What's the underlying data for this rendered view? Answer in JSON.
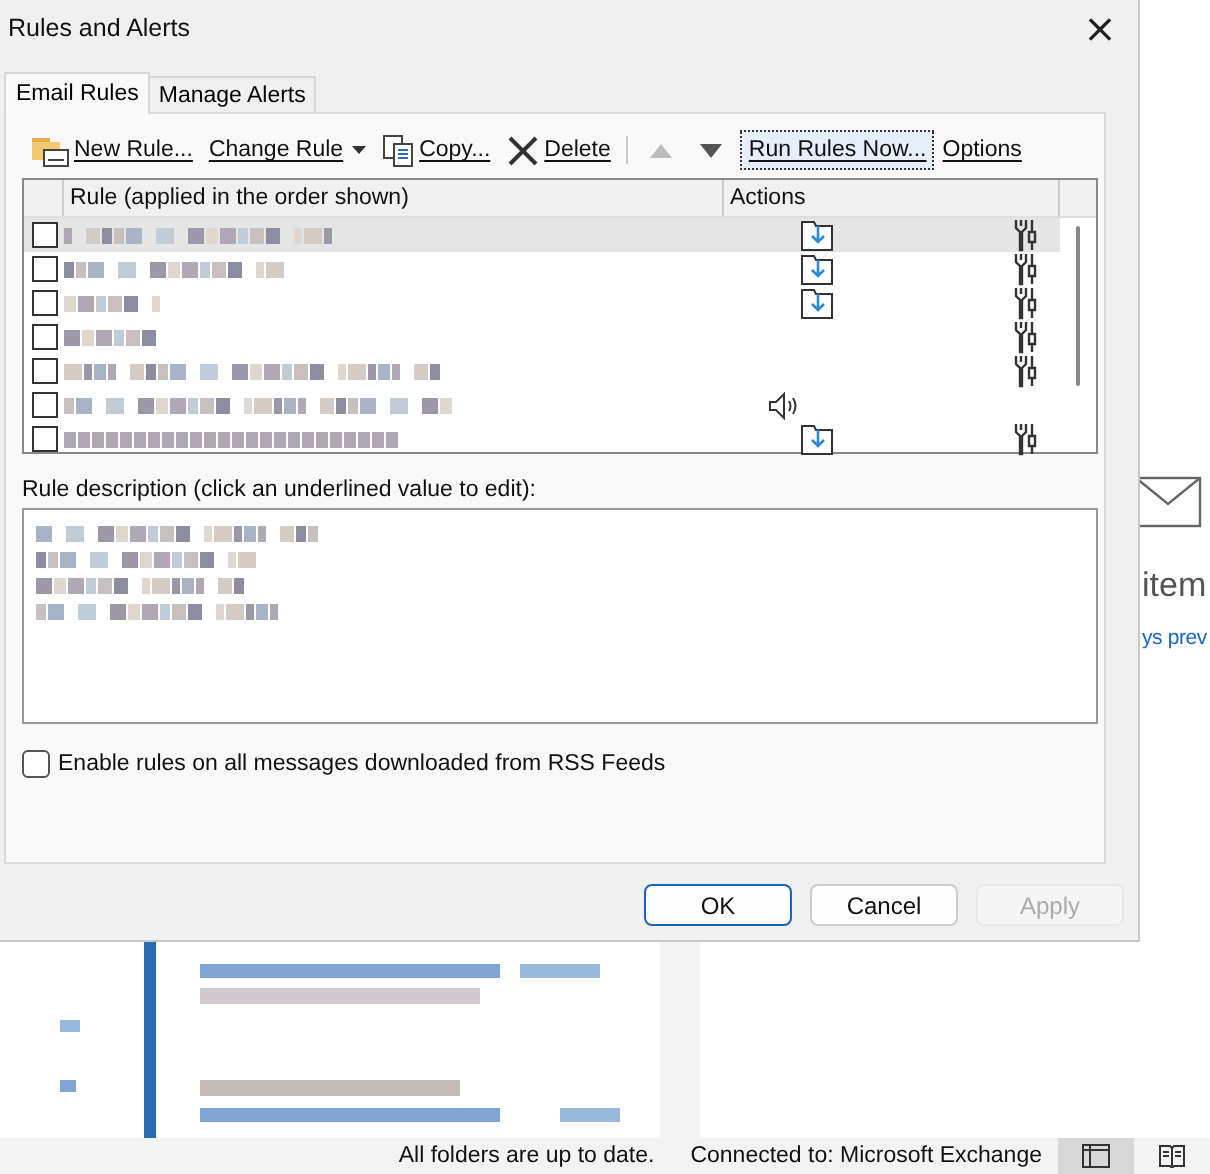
{
  "window": {
    "title": "Rules and Alerts",
    "close": "×"
  },
  "tabs": [
    {
      "label": "Email Rules",
      "selected": true
    },
    {
      "label": "Manage Alerts",
      "selected": false
    }
  ],
  "toolbar": [
    {
      "kind": "new",
      "label": "New Rule...",
      "disabled": false
    },
    {
      "kind": "dropdown",
      "label": "Change Rule",
      "disabled": false
    },
    {
      "kind": "copy",
      "label": "Copy...",
      "disabled": false
    },
    {
      "kind": "delete",
      "label": "Delete",
      "disabled": false
    },
    {
      "kind": "up",
      "disabled": true
    },
    {
      "kind": "down",
      "disabled": false
    },
    {
      "kind": "run",
      "label": "Run Rules Now...",
      "disabled": false
    },
    {
      "kind": "plain",
      "label": "Options",
      "disabled": false
    }
  ],
  "rules_table": {
    "columns": [
      "Rule (applied in the order shown)",
      "Actions"
    ],
    "rows": [
      {
        "selected": true,
        "checked": false,
        "moves_to_folder": true,
        "plays_sound": false,
        "runs_script": true
      },
      {
        "selected": false,
        "checked": false,
        "moves_to_folder": true,
        "plays_sound": false,
        "runs_script": true
      },
      {
        "selected": false,
        "checked": false,
        "moves_to_folder": true,
        "plays_sound": false,
        "runs_script": true
      },
      {
        "selected": false,
        "checked": false,
        "moves_to_folder": false,
        "plays_sound": false,
        "runs_script": true
      },
      {
        "selected": false,
        "checked": false,
        "moves_to_folder": false,
        "plays_sound": false,
        "runs_script": true
      },
      {
        "selected": false,
        "checked": false,
        "moves_to_folder": false,
        "plays_sound": true,
        "runs_script": false
      },
      {
        "selected": false,
        "checked": false,
        "moves_to_folder": true,
        "plays_sound": false,
        "runs_script": true
      }
    ]
  },
  "description": {
    "label": "Rule description (click an underlined value to edit):"
  },
  "rss_option": {
    "label": "Enable rules on all messages downloaded from RSS Feeds",
    "checked": false
  },
  "buttons": [
    {
      "label": "OK",
      "default": true,
      "disabled": false
    },
    {
      "label": "Cancel",
      "default": false,
      "disabled": false
    },
    {
      "label": "Apply",
      "default": false,
      "disabled": true
    }
  ],
  "background": {
    "reading_pane": {
      "title": "item",
      "link": "ys prev"
    },
    "status_bar": {
      "sync": "All folders are up to date.",
      "connection": "Connected to: Microsoft Exchange"
    }
  }
}
